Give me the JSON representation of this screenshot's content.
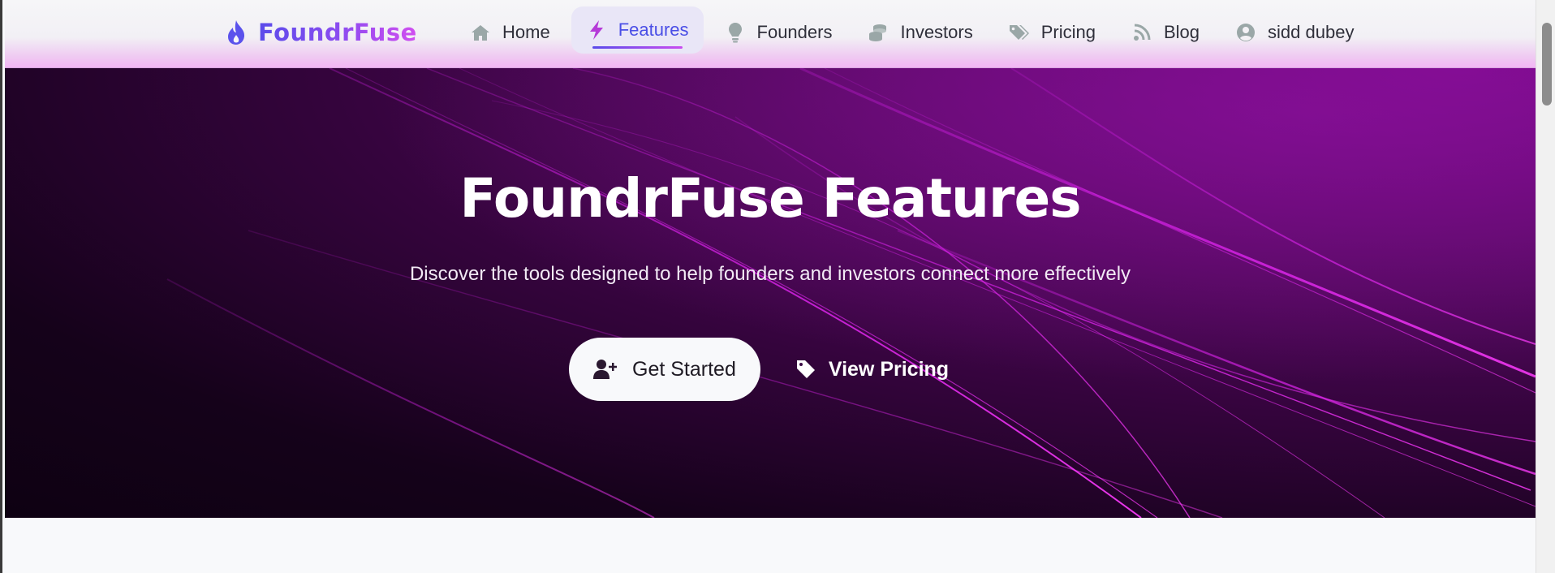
{
  "brand": {
    "name": "FoundrFuse",
    "icon": "flame-icon",
    "gradient": [
      "#5a4bea",
      "#d14ef0"
    ]
  },
  "nav": {
    "items": [
      {
        "label": "Home",
        "icon": "home-icon",
        "active": false
      },
      {
        "label": "Features",
        "icon": "bolt-icon",
        "active": true
      },
      {
        "label": "Founders",
        "icon": "lightbulb-icon",
        "active": false
      },
      {
        "label": "Investors",
        "icon": "coins-icon",
        "active": false
      },
      {
        "label": "Pricing",
        "icon": "tags-icon",
        "active": false
      },
      {
        "label": "Blog",
        "icon": "rss-icon",
        "active": false
      },
      {
        "label": "sidd dubey",
        "icon": "user-circle-icon",
        "active": false
      }
    ]
  },
  "hero": {
    "title": "FoundrFuse Features",
    "subtitle": "Discover the tools designed to help founders and investors connect more effectively",
    "primary_button": {
      "label": "Get Started",
      "icon": "user-plus-icon"
    },
    "secondary_button": {
      "label": "View Pricing",
      "icon": "tag-icon"
    }
  },
  "colors": {
    "accent": "#4a4ee6",
    "hero_dark": "#0e0112",
    "hero_glow": "#e020f0"
  }
}
